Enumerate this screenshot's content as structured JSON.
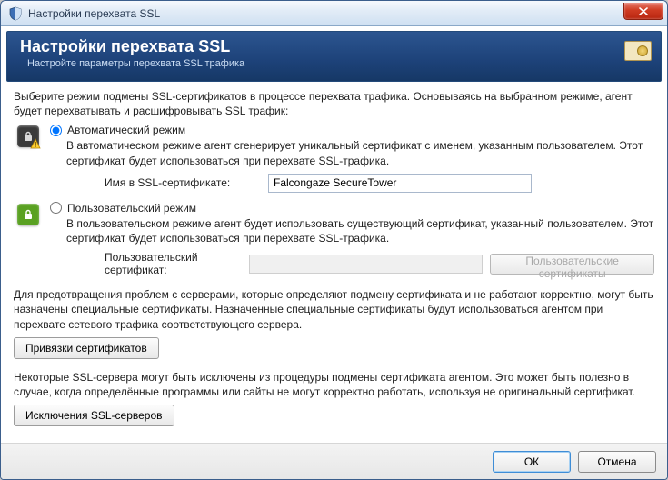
{
  "window": {
    "title": "Настройки перехвата SSL"
  },
  "header": {
    "title": "Настройки перехвата SSL",
    "subtitle": "Настройте параметры перехвата SSL трафика"
  },
  "intro": "Выберите режим подмены SSL-сертификатов в процессе перехвата трафика. Основываясь на выбранном режиме, агент будет перехватывать и расшифровывать SSL трафик:",
  "auto_mode": {
    "label": "Автоматический режим",
    "selected": true,
    "desc": "В автоматическом режиме агент сгенерирует уникальный сертификат с именем, указанным пользователем. Этот сертификат будет использоваться при перехвате SSL-трафика.",
    "field_label": "Имя в SSL-сертификате:",
    "field_value": "Falcongaze SecureTower"
  },
  "user_mode": {
    "label": "Пользовательский режим",
    "selected": false,
    "desc": "В пользовательском режиме агент будет использовать существующий сертификат, указанный пользователем. Этот сертификат будет использоваться при перехвате SSL-трафика.",
    "field_label": "Пользовательский сертификат:",
    "field_value": "",
    "browse_label": "Пользовательские сертификаты"
  },
  "bindings": {
    "para": "Для предотвращения проблем с серверами, которые определяют подмену сертификата и не работают корректно, могут быть назначены специальные сертификаты. Назначенные специальные сертификаты будут использоваться агентом при перехвате сетевого трафика соответствующего сервера.",
    "button": "Привязки сертификатов"
  },
  "exclusions": {
    "para": "Некоторые SSL-сервера могут быть исключены из процедуры подмены сертификата агентом.  Это может быть полезно в случае, когда определённые программы или сайты не могут корректно работать, используя не оригинальный сертификат.",
    "button": "Исключения SSL-серверов"
  },
  "footer": {
    "ok": "ОК",
    "cancel": "Отмена"
  }
}
